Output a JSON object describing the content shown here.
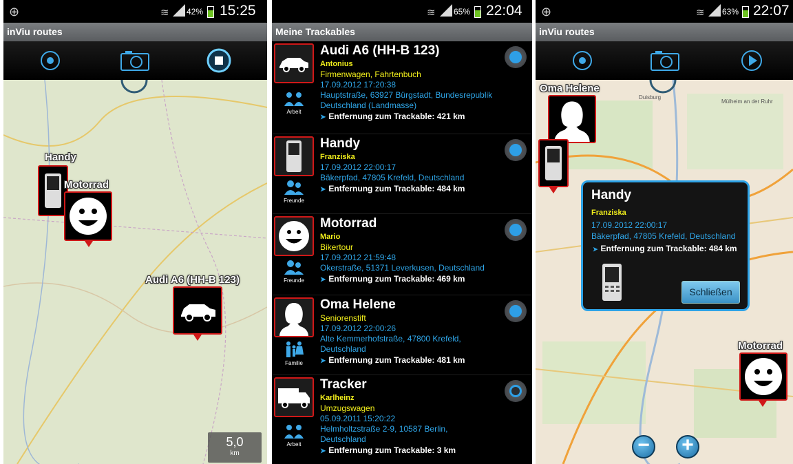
{
  "colors": {
    "accent_blue": "#2fa6e8",
    "owner_yellow": "#f2ef1c",
    "marker_red": "#d01818"
  },
  "screen1": {
    "status": {
      "battery": "42%",
      "time": "15:25"
    },
    "app_title": "inViu routes",
    "toolbar_icons": [
      "target-icon",
      "camera-icon",
      "stop-icon"
    ],
    "markers": {
      "handy": "Handy",
      "motorrad": "Motorrad",
      "audi": "Audi A6 (HH-B 123)"
    },
    "scale": {
      "value": "5,0",
      "unit": "km"
    }
  },
  "screen2": {
    "status": {
      "battery": "65%",
      "time": "22:04"
    },
    "title": "Meine Trackables",
    "items": [
      {
        "title": "Audi A6 (HH-B 123)",
        "owner": "Antonius",
        "note": "Firmenwagen, Fahrtenbuch",
        "date": "17.09.2012 17:20:38",
        "addr1": "Hauptstraße, 63927 Bürgstadt, Bundesrepublik",
        "addr2": "Deutschland (Landmasse)",
        "dist": "Entfernung zum Trackable: 421 km",
        "group": "Arbeit",
        "icon": "car-icon",
        "active": true
      },
      {
        "title": "Handy",
        "owner": "Franziska",
        "note": "",
        "date": "17.09.2012 22:00:17",
        "addr1": "Bäkerpfad, 47805 Krefeld, Deutschland",
        "addr2": "",
        "dist": "Entfernung zum Trackable: 484 km",
        "group": "Freunde",
        "icon": "phone-icon",
        "active": true
      },
      {
        "title": "Motorrad",
        "owner": "Mario",
        "note": "Bikertour",
        "date": "17.09.2012 21:59:48",
        "addr1": "Okerstraße, 51371 Leverkusen, Deutschland",
        "addr2": "",
        "dist": "Entfernung zum Trackable: 469 km",
        "group": "Freunde",
        "icon": "smiley-icon",
        "active": true
      },
      {
        "title": "Oma Helene",
        "owner": "",
        "note": "Seniorenstift",
        "date": "17.09.2012 22:00:26",
        "addr1": "Alte Kemmerhofstraße, 47800 Krefeld,",
        "addr2": "Deutschland",
        "dist": "Entfernung zum Trackable: 481 km",
        "group": "Familie",
        "icon": "person-icon",
        "active": true
      },
      {
        "title": "Tracker",
        "owner": "Karlheinz",
        "note": "Umzugswagen",
        "date": "05.09.2011 15:20:22",
        "addr1": "Helmholtzstraße 2-9, 10587 Berlin,",
        "addr2": "Deutschland",
        "dist": "Entfernung zum Trackable: 3 km",
        "group": "Arbeit",
        "icon": "truck-icon",
        "active": false
      }
    ]
  },
  "screen3": {
    "status": {
      "battery": "63%",
      "time": "22:07"
    },
    "app_title": "inViu routes",
    "toolbar_icons": [
      "target-icon",
      "camera-icon",
      "play-icon"
    ],
    "markers": {
      "oma": "Oma Helene",
      "motorrad": "Motorrad"
    },
    "popup": {
      "title": "Handy",
      "owner": "Franziska",
      "date": "17.09.2012 22:00:17",
      "addr": "Bäkerpfad, 47805 Krefeld, Deutschland",
      "dist": "Entfernung zum Trackable: 484 km",
      "close_label": "Schließen"
    },
    "map_labels": {
      "duisburg": "Duisburg",
      "mulheim": "Mülheim an der Ruhr"
    },
    "zoom": {
      "minus": "−",
      "plus": "+"
    }
  }
}
